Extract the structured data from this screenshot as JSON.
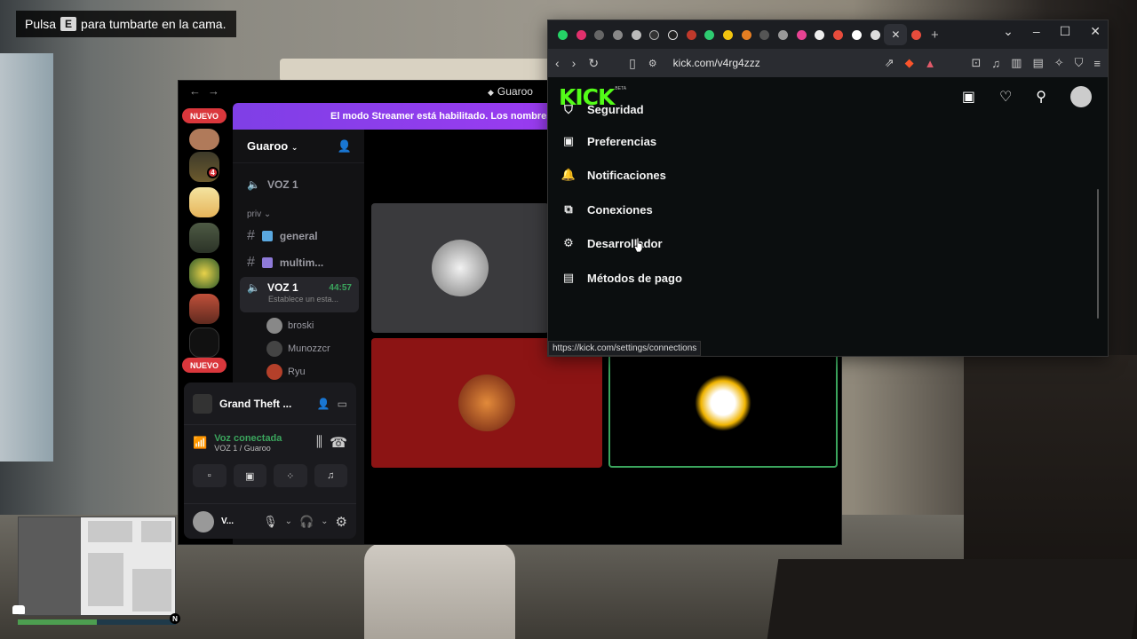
{
  "game": {
    "hint_before": "Pulsa",
    "hint_key": "E",
    "hint_after": "para tumbarte en la cama.",
    "compass": "N"
  },
  "discord": {
    "title": "Guaroo",
    "new_badge": "NUEVO",
    "server_badge_count": "4",
    "streamer_banner": "El modo Streamer está habilitado. Los nombres de",
    "guild_name": "Guaroo",
    "channels": {
      "voice_top": "VOZ 1",
      "category": "priv",
      "text_general": "general",
      "text_multim": "multim...",
      "voice_active": "VOZ 1",
      "voice_active_timer": "44:57",
      "voice_active_status": "Establece un esta..."
    },
    "voice_users": [
      "broski",
      "Munozzcr",
      "Ryu"
    ],
    "activity": "Grand Theft ...",
    "voice_connected": "Voz conectada",
    "voice_location": "VOZ 1 / Guaroo",
    "self_name": "V..."
  },
  "browser": {
    "url": "kick.com/v4rg4zzz",
    "status_url": "https://kick.com/settings/connections",
    "logo": "KICK",
    "logo_beta": "BETA",
    "menu": [
      {
        "label": "Seguridad",
        "icon": "shield-icon"
      },
      {
        "label": "Preferencias",
        "icon": "preferences-icon"
      },
      {
        "label": "Notificaciones",
        "icon": "bell-icon"
      },
      {
        "label": "Conexiones",
        "icon": "connections-icon"
      },
      {
        "label": "Desarrollador",
        "icon": "developer-icon"
      },
      {
        "label": "Métodos de pago",
        "icon": "wallet-icon"
      }
    ]
  },
  "colors": {
    "kick_green": "#53fc18",
    "discord_purple": "#8a2be2",
    "connected_green": "#3ba55d",
    "badge_red": "#da373c"
  }
}
